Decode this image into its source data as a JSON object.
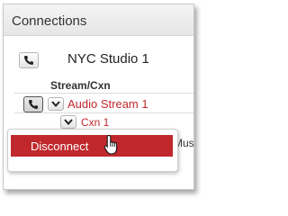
{
  "header": {
    "title": "Connections"
  },
  "studio": {
    "name": "NYC Studio 1"
  },
  "table": {
    "column_header": "Stream/Cxn"
  },
  "rows": [
    {
      "stream_label": "Audio Stream 1"
    },
    {
      "cxn_label": "Cxn 1"
    }
  ],
  "context_menu": {
    "items": [
      {
        "label": "Disconnect"
      }
    ]
  },
  "background_row": {
    "partial_label": "Music"
  },
  "colors": {
    "accent": "#c0282d",
    "header_bg": "#eeeeee"
  },
  "icons": {
    "phone": "phone-icon",
    "dropdown": "chevron-down-icon",
    "cursor": "hand-pointer-icon"
  }
}
